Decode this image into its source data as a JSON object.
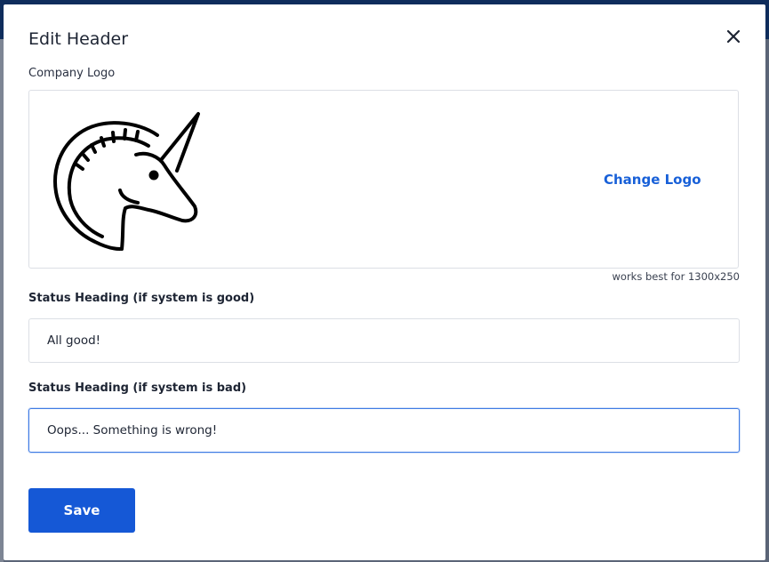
{
  "modal": {
    "title": "Edit Header",
    "close_icon": "close-icon"
  },
  "logo_section": {
    "label": "Company Logo",
    "logo_icon": "unicorn-logo",
    "change_label": "Change Logo",
    "hint": "works best for 1300x250"
  },
  "good_status": {
    "label": "Status Heading (if system is good)",
    "value": "All good!"
  },
  "bad_status": {
    "label": "Status Heading (if system is bad)",
    "value": "Oops... Something is wrong!"
  },
  "actions": {
    "save_label": "Save"
  },
  "colors": {
    "accent": "#1558d6",
    "link": "#1860d8",
    "focus_border": "#3f7be4"
  }
}
